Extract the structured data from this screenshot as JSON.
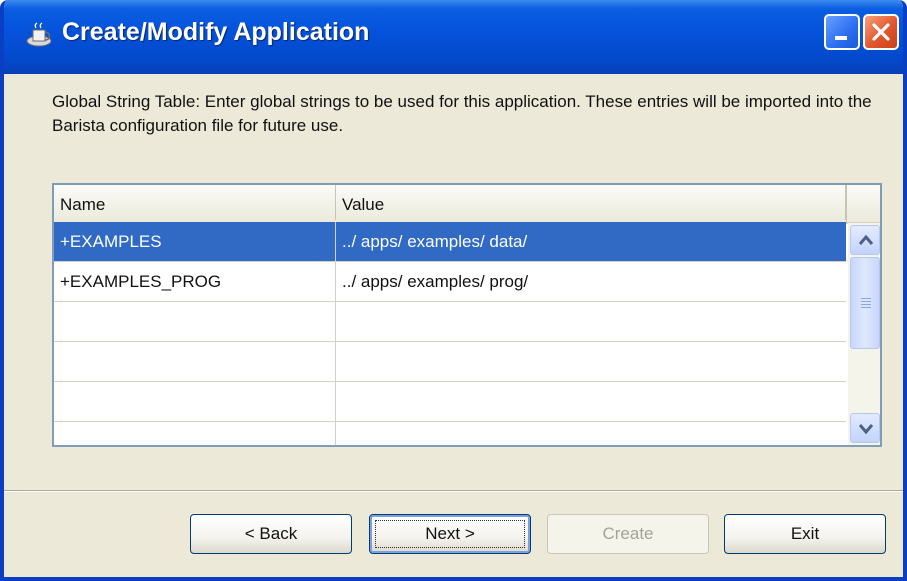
{
  "window": {
    "title": "Create/Modify Application",
    "app_icon": "application-icon",
    "controls": [
      "minimize-icon",
      "close-icon"
    ]
  },
  "description": "Global String Table: Enter global strings to be used for this application.  These entries will be imported into the Barista configuration file for future use.",
  "table": {
    "columns": [
      "Name",
      "Value"
    ],
    "rows": [
      {
        "name": "+EXAMPLES",
        "value": "../ apps/ examples/ data/",
        "selected": true
      },
      {
        "name": "+EXAMPLES_PROG",
        "value": "../ apps/ examples/ prog/",
        "selected": false
      },
      {
        "name": "",
        "value": "",
        "selected": false
      },
      {
        "name": "",
        "value": "",
        "selected": false
      },
      {
        "name": "",
        "value": "",
        "selected": false
      }
    ]
  },
  "buttons": {
    "back": "< Back",
    "next": "Next >",
    "create": "Create",
    "exit": "Exit"
  },
  "colors": {
    "titlebar": "#0553dc",
    "selection": "#316ac5",
    "window_bg": "#ece9d8",
    "close_button": "#e1572e"
  }
}
